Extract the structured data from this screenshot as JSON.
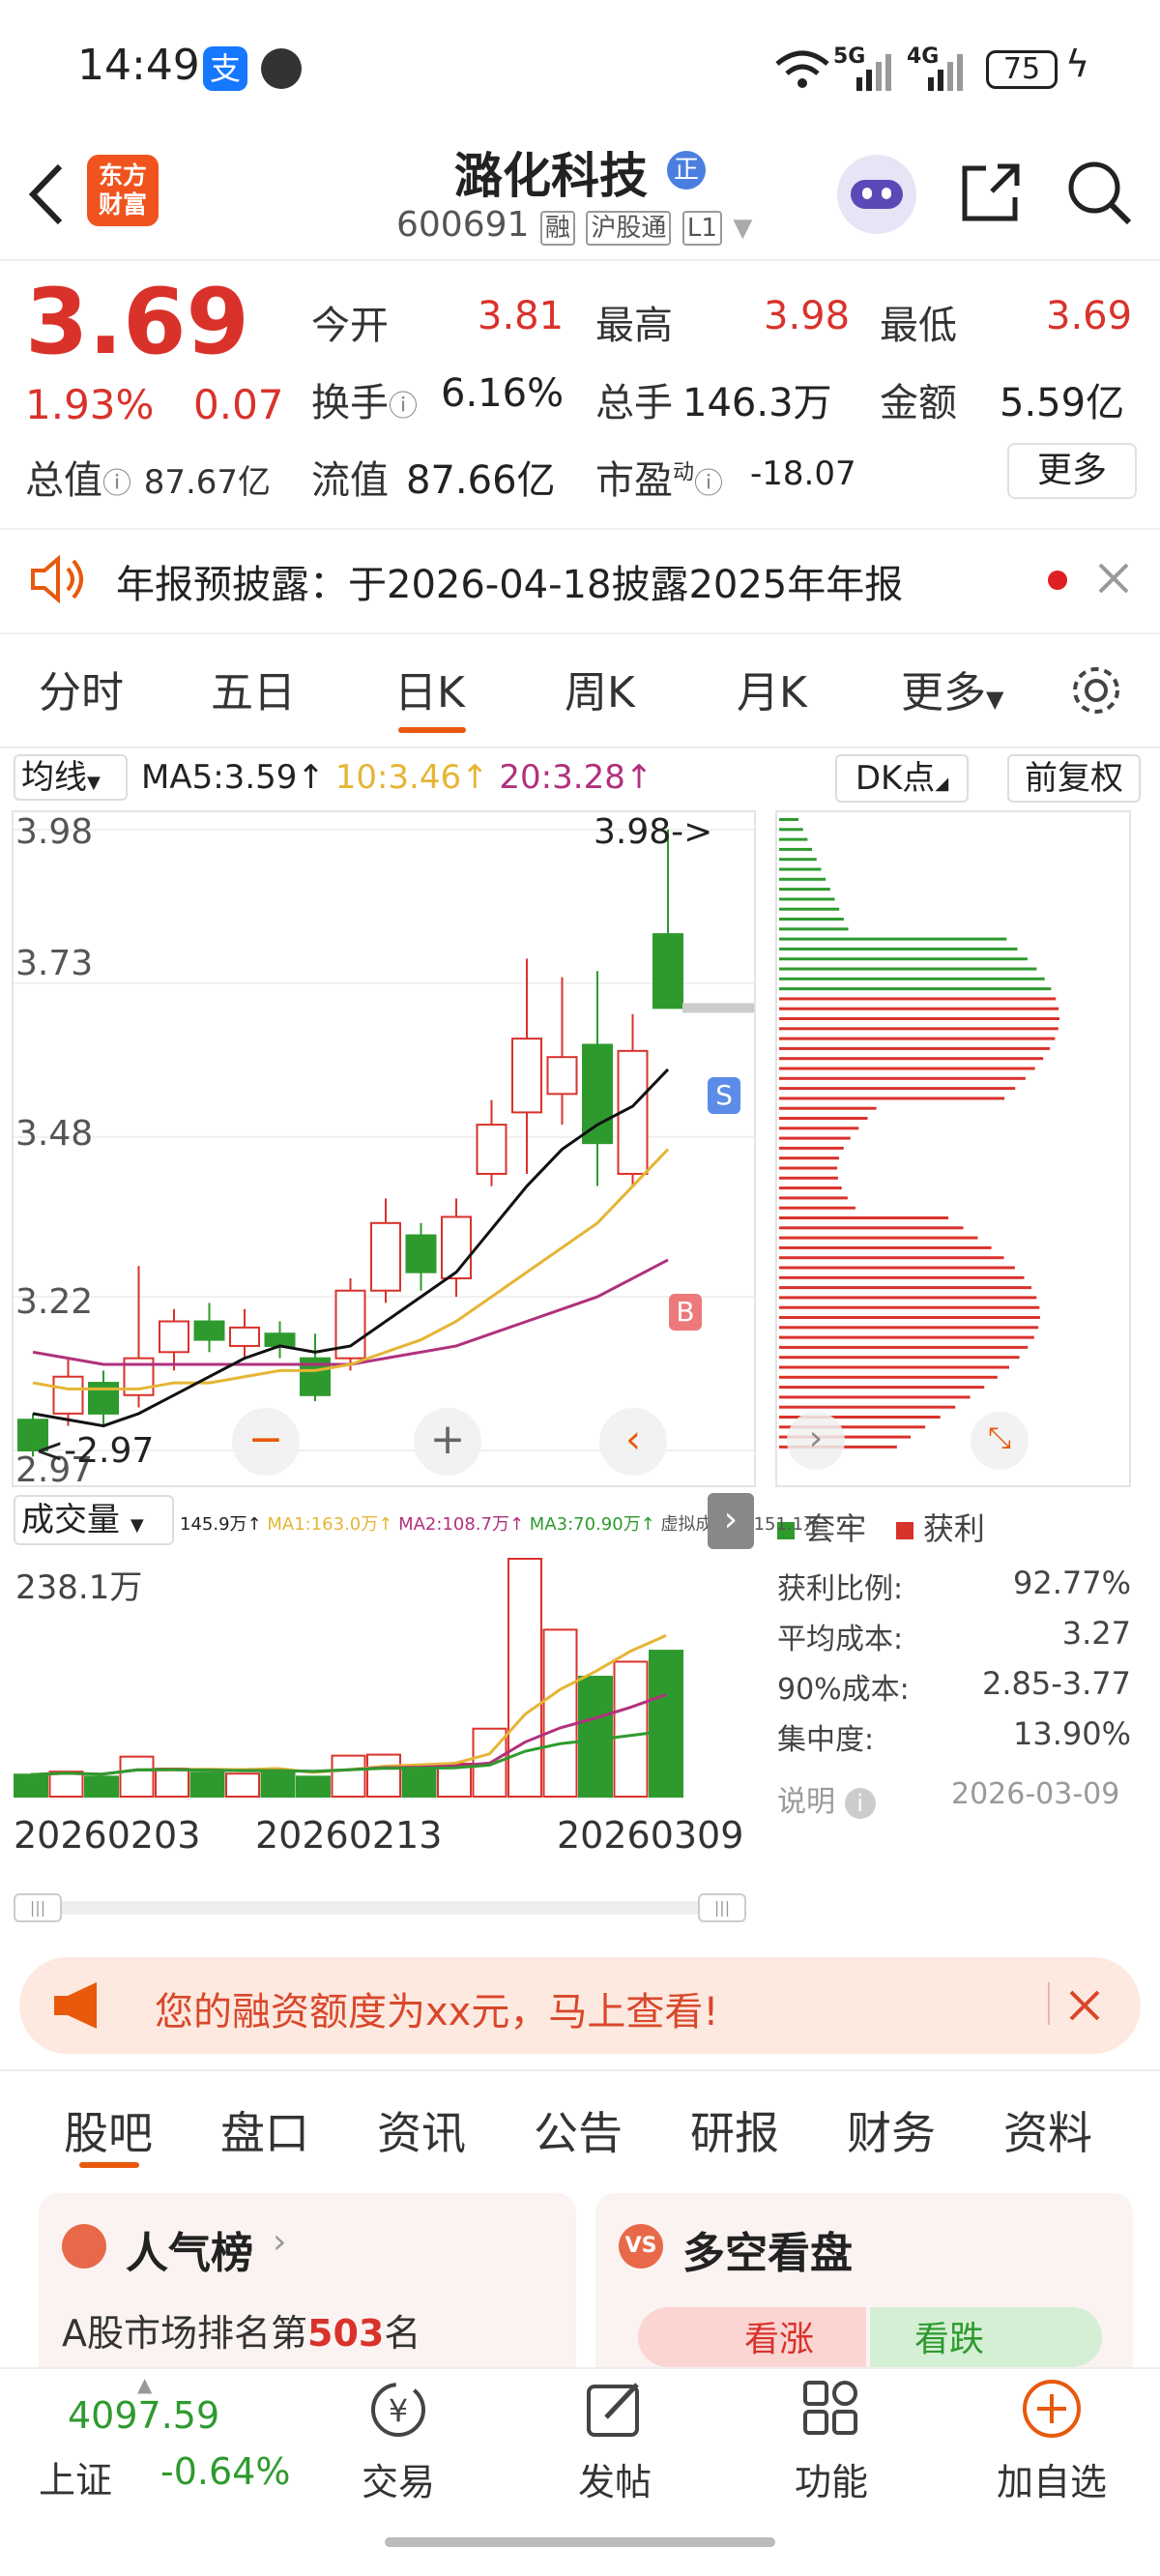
{
  "status_bar": {
    "time": "14:49",
    "net1": "5G",
    "net2": "4G",
    "battery": "75"
  },
  "header": {
    "title": "潞化科技",
    "title_badge": "正",
    "code": "600691",
    "tags": [
      "融",
      "沪股通",
      "L1"
    ],
    "logo_line1": "东方",
    "logo_line2": "财富"
  },
  "quote": {
    "price": "3.69",
    "change_pct": "1.93%",
    "change": "0.07",
    "open_label": "今开",
    "open": "3.81",
    "high_label": "最高",
    "high": "3.98",
    "low_label": "最低",
    "low": "3.69",
    "turnover_label": "换手",
    "turnover": "6.16%",
    "volume_label": "总手",
    "volume": "146.3万",
    "amount_label": "金额",
    "amount": "5.59亿",
    "mcap_label": "总值",
    "mcap": "87.67亿",
    "float_label": "流值",
    "float": "87.66亿",
    "pe_label": "市盈",
    "pe_sup": "动",
    "pe": "-18.07",
    "more": "更多"
  },
  "notice": {
    "text": "年报预披露：于2026-04-18披露2025年年报"
  },
  "period_tabs": [
    "分时",
    "五日",
    "日K",
    "周K",
    "月K",
    "更多"
  ],
  "chart_toolbar": {
    "indicator": "均线",
    "ma5": "MA5:3.59↑",
    "ma10": "10:3.46↑",
    "ma20": "20:3.28↑",
    "dk": "DK点",
    "adjust": "前复权"
  },
  "chart_labels": {
    "top_marker": "3.98->",
    "low_marker": "<-2.97",
    "s_badge": "S",
    "b_badge": "B"
  },
  "volume_bar": {
    "label": "成交量",
    "v": "145.9万↑",
    "ma1": "MA1:163.0万↑",
    "ma2": "MA2:108.7万↑",
    "ma3": "MA3:70.90万↑",
    "virtual": "虚拟成交量:151.1万",
    "max_label": "238.1万"
  },
  "chip": {
    "legend_loss": "套牢",
    "legend_profit": "获利",
    "stats": [
      {
        "label": "获利比例:",
        "value": "92.77%"
      },
      {
        "label": "平均成本:",
        "value": "3.27"
      },
      {
        "label": "90%成本:",
        "value": "2.85-3.77"
      },
      {
        "label": "集中度:",
        "value": "13.90%"
      }
    ],
    "note": "说明",
    "date": "2026-03-09"
  },
  "banner": {
    "text": "您的融资额度为xx元，马上查看!"
  },
  "bottom_tabs": [
    "股吧",
    "盘口",
    "资讯",
    "公告",
    "研报",
    "财务",
    "资料"
  ],
  "cards": {
    "popularity_title": "人气榜",
    "popularity_text_pre": "A股市场排名第",
    "popularity_rank": "503",
    "popularity_text_post": "名",
    "bullbear_title": "多空看盘",
    "bull": "看涨",
    "bear": "看跌"
  },
  "bottom_nav": {
    "index_value": "4097.59",
    "index_name": "上证",
    "index_change": "-0.64%",
    "items": [
      "交易",
      "发帖",
      "功能",
      "加自选"
    ]
  },
  "colors": {
    "up": "#d9322b",
    "down": "#2e9a2e",
    "accent": "#e8590c"
  },
  "chart_data": {
    "type": "candlestick",
    "ylim": [
      2.97,
      3.98
    ],
    "y_ticks": [
      "3.98",
      "3.73",
      "3.48",
      "3.22",
      "2.97"
    ],
    "x_ticks": [
      "20260203",
      "20260213",
      "20260309"
    ],
    "candles": [
      {
        "o": 3.02,
        "c": 2.97,
        "h": 3.03,
        "l": 2.96
      },
      {
        "o": 3.03,
        "c": 3.09,
        "h": 3.12,
        "l": 3.01
      },
      {
        "o": 3.08,
        "c": 3.03,
        "h": 3.1,
        "l": 3.01
      },
      {
        "o": 3.06,
        "c": 3.12,
        "h": 3.27,
        "l": 3.04
      },
      {
        "o": 3.13,
        "c": 3.18,
        "h": 3.2,
        "l": 3.1
      },
      {
        "o": 3.18,
        "c": 3.15,
        "h": 3.21,
        "l": 3.13
      },
      {
        "o": 3.14,
        "c": 3.17,
        "h": 3.2,
        "l": 3.12
      },
      {
        "o": 3.16,
        "c": 3.14,
        "h": 3.18,
        "l": 3.12
      },
      {
        "o": 3.12,
        "c": 3.06,
        "h": 3.16,
        "l": 3.05
      },
      {
        "o": 3.12,
        "c": 3.23,
        "h": 3.25,
        "l": 3.1
      },
      {
        "o": 3.23,
        "c": 3.34,
        "h": 3.38,
        "l": 3.21
      },
      {
        "o": 3.32,
        "c": 3.26,
        "h": 3.34,
        "l": 3.23
      },
      {
        "o": 3.25,
        "c": 3.35,
        "h": 3.38,
        "l": 3.22
      },
      {
        "o": 3.42,
        "c": 3.5,
        "h": 3.54,
        "l": 3.4
      },
      {
        "o": 3.52,
        "c": 3.64,
        "h": 3.77,
        "l": 3.42
      },
      {
        "o": 3.55,
        "c": 3.61,
        "h": 3.74,
        "l": 3.5
      },
      {
        "o": 3.63,
        "c": 3.47,
        "h": 3.75,
        "l": 3.4
      },
      {
        "o": 3.42,
        "c": 3.62,
        "h": 3.68,
        "l": 3.4
      },
      {
        "o": 3.81,
        "c": 3.69,
        "h": 3.98,
        "l": 3.69
      }
    ],
    "ma5": [
      3.03,
      3.02,
      3.01,
      3.03,
      3.06,
      3.09,
      3.12,
      3.14,
      3.13,
      3.14,
      3.18,
      3.22,
      3.26,
      3.33,
      3.4,
      3.46,
      3.5,
      3.53,
      3.59
    ],
    "ma10": [
      3.08,
      3.07,
      3.07,
      3.07,
      3.08,
      3.08,
      3.09,
      3.1,
      3.1,
      3.11,
      3.13,
      3.15,
      3.18,
      3.22,
      3.26,
      3.3,
      3.34,
      3.4,
      3.46
    ],
    "ma20": [
      3.13,
      3.12,
      3.11,
      3.11,
      3.11,
      3.11,
      3.11,
      3.11,
      3.11,
      3.11,
      3.12,
      3.13,
      3.14,
      3.16,
      3.18,
      3.2,
      3.22,
      3.25,
      3.28
    ],
    "volume": [
      22,
      25,
      20,
      40,
      28,
      24,
      23,
      26,
      20,
      41,
      42,
      30,
      33,
      68,
      238,
      167,
      120,
      135,
      146
    ],
    "vol_max": 238
  }
}
